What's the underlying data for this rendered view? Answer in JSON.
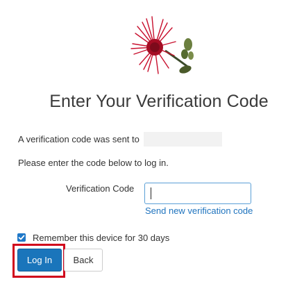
{
  "page": {
    "title": "Enter Your Verification Code",
    "sent_message": "A verification code was sent to",
    "instructions": "Please enter the code below to log in."
  },
  "form": {
    "code_label": "Verification Code",
    "code_value": "",
    "resend_link": "Send new verification code",
    "remember_label": "Remember this device for 30 days",
    "remember_checked": true,
    "login_label": "Log In",
    "back_label": "Back"
  },
  "colors": {
    "primary": "#1a75bb",
    "link": "#1e73be",
    "highlight": "#d0021b",
    "flower": "#c8102e"
  },
  "icons": {
    "logo": "ohia-lehua-flower-logo",
    "checkbox": "checkmark-icon"
  }
}
